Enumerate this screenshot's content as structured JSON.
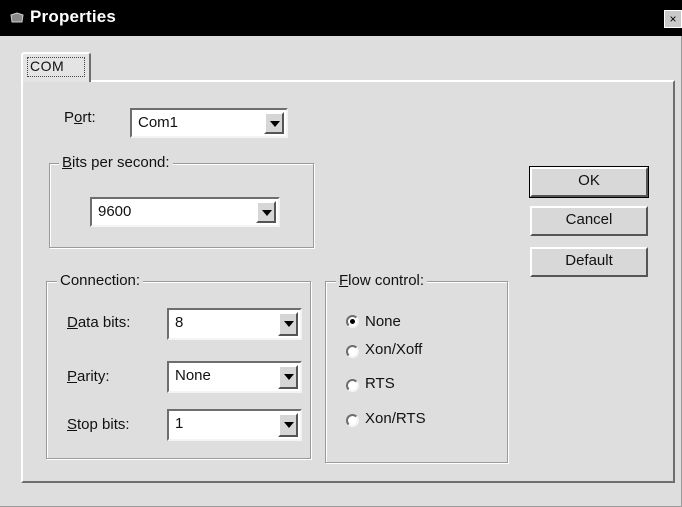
{
  "window": {
    "title": "Properties",
    "close_glyph": "×"
  },
  "tabs": [
    {
      "label": "COM"
    }
  ],
  "port": {
    "label": "Port:",
    "value": "Com1"
  },
  "bits_per_second": {
    "legend": "Bits per second:",
    "value": "9600"
  },
  "connection": {
    "legend": "Connection:",
    "data_bits": {
      "label": "Data bits:",
      "value": "8"
    },
    "parity": {
      "label": "Parity:",
      "value": "None"
    },
    "stop_bits": {
      "label": "Stop bits:",
      "value": "1"
    }
  },
  "flow_control": {
    "legend": "Flow control:",
    "options": [
      {
        "label": "None",
        "selected": true
      },
      {
        "label": "Xon/Xoff",
        "selected": false
      },
      {
        "label": "RTS",
        "selected": false
      },
      {
        "label": "Xon/RTS",
        "selected": false
      }
    ]
  },
  "buttons": {
    "ok": "OK",
    "cancel": "Cancel",
    "default": "Default"
  },
  "icons": {
    "window_icon": "app-icon",
    "dropdown": "chevron-down-icon"
  }
}
